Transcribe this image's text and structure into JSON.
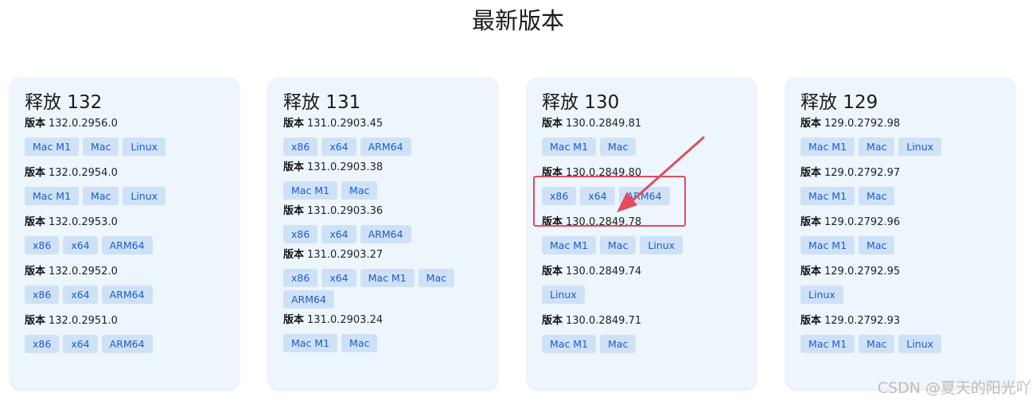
{
  "page": {
    "title": "最新版本"
  },
  "cards": [
    {
      "title": "释放 132",
      "versions": [
        {
          "prefix": "版本",
          "number": "132.0.2956.0",
          "buttons": [
            "Mac M1",
            "Mac",
            "Linux"
          ]
        },
        {
          "prefix": "版本",
          "number": "132.0.2954.0",
          "buttons": [
            "Mac M1",
            "Mac",
            "Linux"
          ]
        },
        {
          "prefix": "版本",
          "number": "132.0.2953.0",
          "buttons": [
            "x86",
            "x64",
            "ARM64"
          ]
        },
        {
          "prefix": "版本",
          "number": "132.0.2952.0",
          "buttons": [
            "x86",
            "x64",
            "ARM64"
          ]
        },
        {
          "prefix": "版本",
          "number": "132.0.2951.0",
          "buttons": [
            "x86",
            "x64",
            "ARM64"
          ]
        }
      ]
    },
    {
      "title": "释放 131",
      "versions": [
        {
          "prefix": "版本",
          "number": "131.0.2903.45",
          "buttons": [
            "x86",
            "x64",
            "ARM64"
          ]
        },
        {
          "prefix": "版本",
          "number": "131.0.2903.38",
          "buttons": [
            "Mac M1",
            "Mac"
          ]
        },
        {
          "prefix": "版本",
          "number": "131.0.2903.36",
          "buttons": [
            "x86",
            "x64",
            "ARM64"
          ]
        },
        {
          "prefix": "版本",
          "number": "131.0.2903.27",
          "buttons": [
            "x86",
            "x64",
            "Mac M1",
            "Mac",
            "ARM64"
          ]
        },
        {
          "prefix": "版本",
          "number": "131.0.2903.24",
          "buttons": [
            "Mac M1",
            "Mac"
          ]
        }
      ]
    },
    {
      "title": "释放 130",
      "versions": [
        {
          "prefix": "版本",
          "number": "130.0.2849.81",
          "buttons": [
            "Mac M1",
            "Mac"
          ]
        },
        {
          "prefix": "版本",
          "number": "130.0.2849.80",
          "buttons": [
            "x86",
            "x64",
            "ARM64"
          ]
        },
        {
          "prefix": "版本",
          "number": "130.0.2849.78",
          "buttons": [
            "Mac M1",
            "Mac",
            "Linux"
          ]
        },
        {
          "prefix": "版本",
          "number": "130.0.2849.74",
          "buttons": [
            "Linux"
          ]
        },
        {
          "prefix": "版本",
          "number": "130.0.2849.71",
          "buttons": [
            "Mac M1",
            "Mac"
          ]
        }
      ]
    },
    {
      "title": "释放 129",
      "versions": [
        {
          "prefix": "版本",
          "number": "129.0.2792.98",
          "buttons": [
            "Mac M1",
            "Mac",
            "Linux"
          ]
        },
        {
          "prefix": "版本",
          "number": "129.0.2792.97",
          "buttons": [
            "Mac M1",
            "Mac"
          ]
        },
        {
          "prefix": "版本",
          "number": "129.0.2792.96",
          "buttons": [
            "Mac M1",
            "Mac"
          ]
        },
        {
          "prefix": "版本",
          "number": "129.0.2792.95",
          "buttons": [
            "Linux"
          ]
        },
        {
          "prefix": "版本",
          "number": "129.0.2792.93",
          "buttons": [
            "Mac M1",
            "Mac",
            "Linux"
          ]
        }
      ]
    }
  ],
  "annotation": {
    "color": "#e24b5e",
    "arrow_icon": "arrow-annotation-icon"
  },
  "watermark": "CSDN @夏天的阳光吖",
  "colors": {
    "card_bg": "#eef6fd",
    "button_bg": "#cfe1f7",
    "button_text": "#1b5cc9"
  }
}
